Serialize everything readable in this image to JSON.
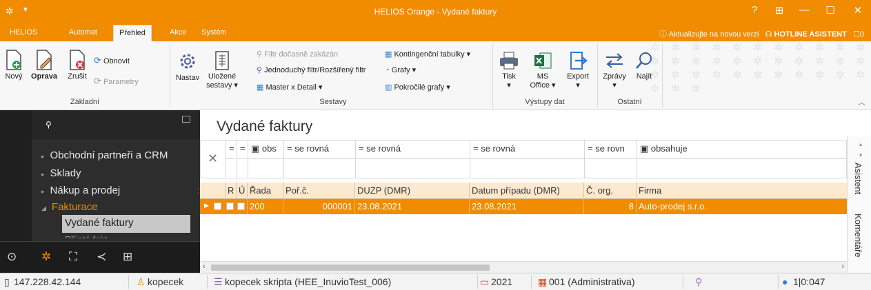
{
  "window": {
    "title": "HELIOS Orange - Vydané faktury",
    "help": "?",
    "restore_icon": "⊞",
    "minimize": "—",
    "maximize": "☐",
    "close": "✕"
  },
  "ribbon_tabs": {
    "helios": "HELIOS",
    "automat": "Automat",
    "prehled": "Přehled",
    "akce": "Akce",
    "system": "Systém",
    "update_notice": "ⓘ Aktualizujte na novou verzi",
    "hotline": "HOTLINE ASISTENT",
    "message_count": "0"
  },
  "ribbon": {
    "zakladni": {
      "label": "Základní",
      "novy": "Nový",
      "oprava": "Oprava",
      "zrusit": "Zrušit",
      "obnovit": "Obnovit",
      "parametry": "Parametry"
    },
    "nastav": "Nastav",
    "sestavy": {
      "label": "Sestavy",
      "ulozene_line1": "Uložené",
      "ulozene_line2": "sestavy ▾",
      "filtr_docasne": "Filtr dočasně zakázán",
      "jednoduchy_filtr": "Jednoduchý filtr/Rozšířený filtr",
      "master_detail": "Master x Detail ▾",
      "kontingencni": "Kontingenční tabulky ▾",
      "grafy": "Grafy ▾",
      "pokrocile_grafy": "Pokročilé grafy ▾"
    },
    "vystupy": {
      "label": "Výstupy dat",
      "tisk": "Tisk",
      "ms_office_line1": "MS",
      "ms_office_line2": "Office ▾",
      "export": "Export"
    },
    "ostatni": {
      "label": "Ostatní",
      "zpravy": "Zprávy",
      "najit": "Najít"
    }
  },
  "sidebar": {
    "items": [
      {
        "label": "Obchodní partneři a CRM"
      },
      {
        "label": "Sklady"
      },
      {
        "label": "Nákup a prodej"
      },
      {
        "label": "Fakturace"
      }
    ],
    "selected_sub": "Vydané faktury",
    "next_sub_partial": "Přijaté fakt"
  },
  "main": {
    "page_title": "Vydané faktury",
    "filters": {
      "r": "=",
      "u": "=",
      "rada": "▣ obs",
      "porc": "= se rovná",
      "duzp": "= se rovná",
      "datum": "= se rovná",
      "corg": "= se rovn",
      "firma": "▣ obsahuje"
    },
    "columns": {
      "r": "R",
      "u": "Ú",
      "rada": "Řada",
      "porc": "Poř.č.",
      "duzp": "DUZP (DMR)",
      "datum": "Datum případu (DMR)",
      "corg": "Č. org.",
      "firma": "Firma"
    },
    "rows": [
      {
        "rada": "200",
        "porc": "000001",
        "duzp": "23.08.2021",
        "datum": "23.08.2021",
        "corg": "8",
        "firma": "Auto-prodej s.r.o."
      }
    ]
  },
  "side_tabs": {
    "asistent": "Asistent",
    "komentare": "Komentáře"
  },
  "status": {
    "ip": "147.228.42.144",
    "user": "kopecek",
    "db": "kopecek skripta (HEE_InuvioTest_006)",
    "year": "2021",
    "org": "001 (Administrativa)",
    "info": "1|0:047"
  }
}
